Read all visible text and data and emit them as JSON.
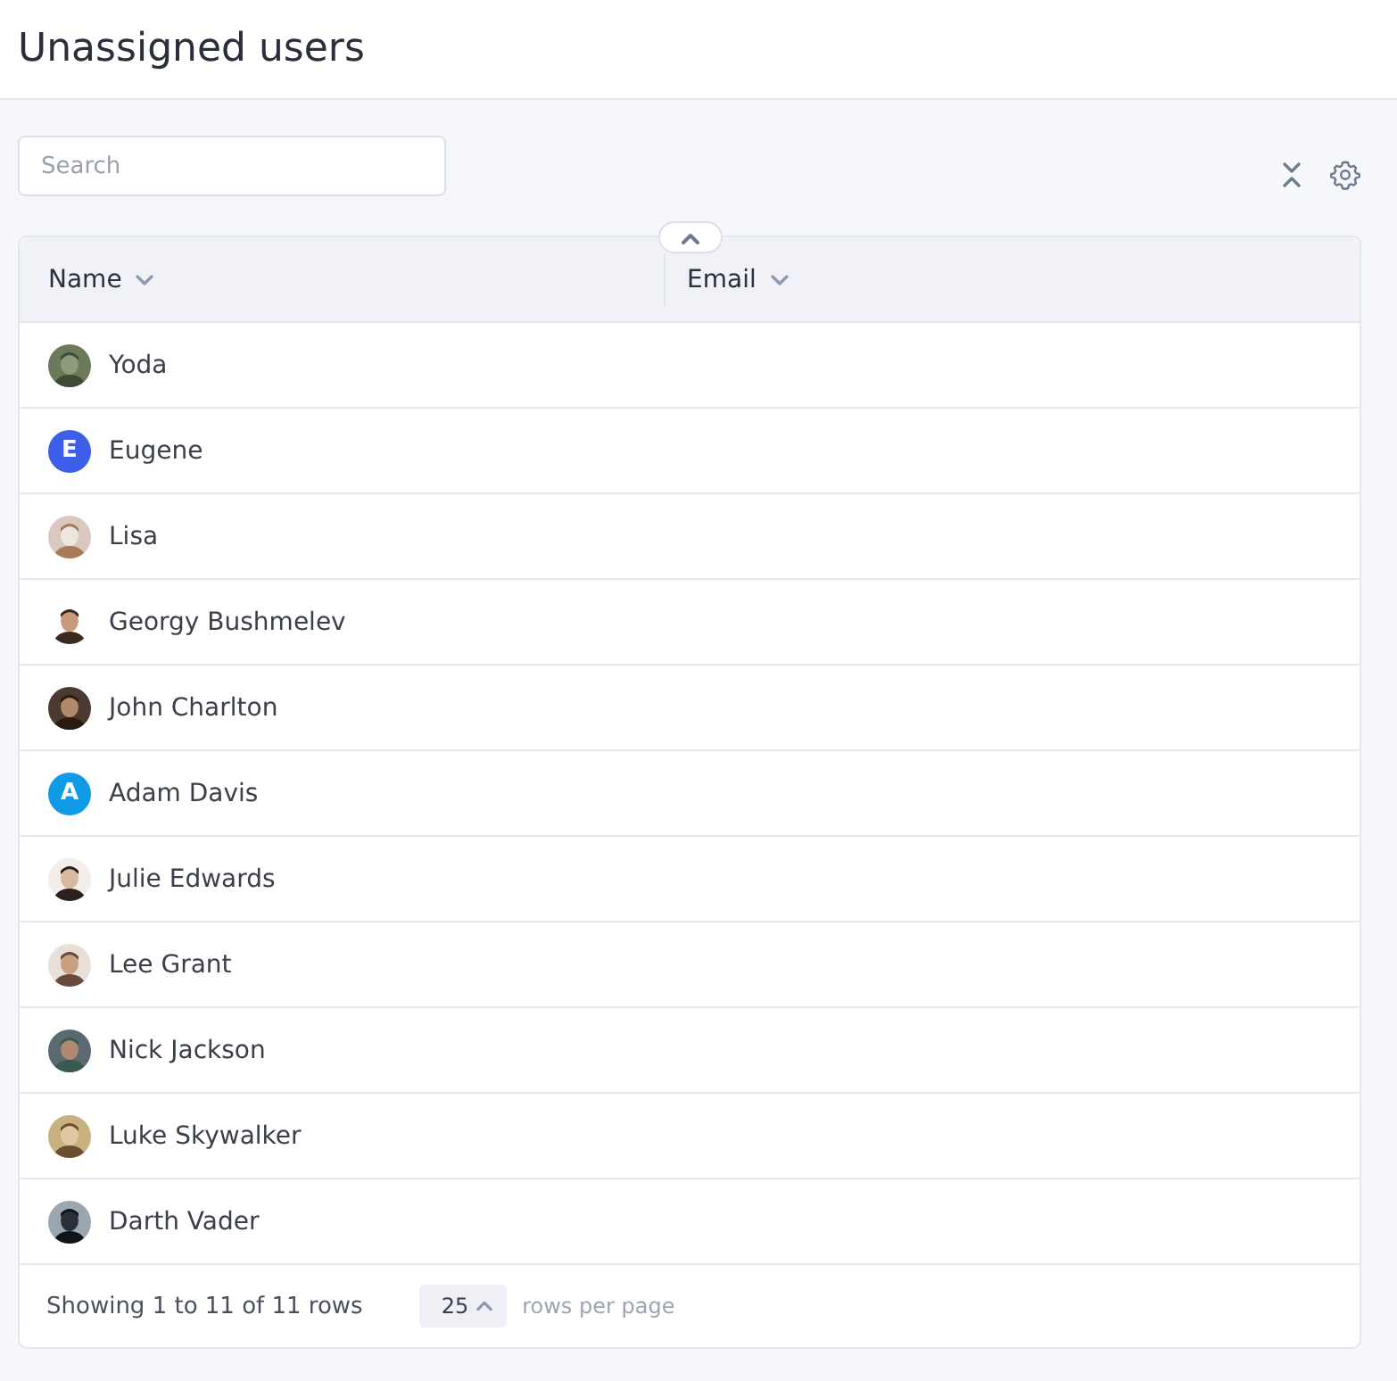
{
  "page": {
    "title": "Unassigned users"
  },
  "search": {
    "placeholder": "Search"
  },
  "table": {
    "columns": [
      {
        "label": "Name"
      },
      {
        "label": "Email"
      }
    ],
    "rows": [
      {
        "name": "Yoda"
      },
      {
        "name": "Eugene",
        "avatar": {
          "kind": "initial",
          "text": "E",
          "color": "#3d5ee8"
        }
      },
      {
        "name": "Lisa"
      },
      {
        "name": "Georgy Bushmelev"
      },
      {
        "name": "John Charlton"
      },
      {
        "name": "Adam Davis",
        "avatar": {
          "kind": "initial",
          "text": "A",
          "color": "#0f9be6"
        }
      },
      {
        "name": "Julie Edwards"
      },
      {
        "name": "Lee Grant"
      },
      {
        "name": "Nick Jackson"
      },
      {
        "name": "Luke Skywalker"
      },
      {
        "name": "Darth Vader"
      }
    ]
  },
  "footer": {
    "summary": "Showing 1 to 11 of 11 rows",
    "page_size": "25",
    "page_size_label": "rows per page"
  }
}
